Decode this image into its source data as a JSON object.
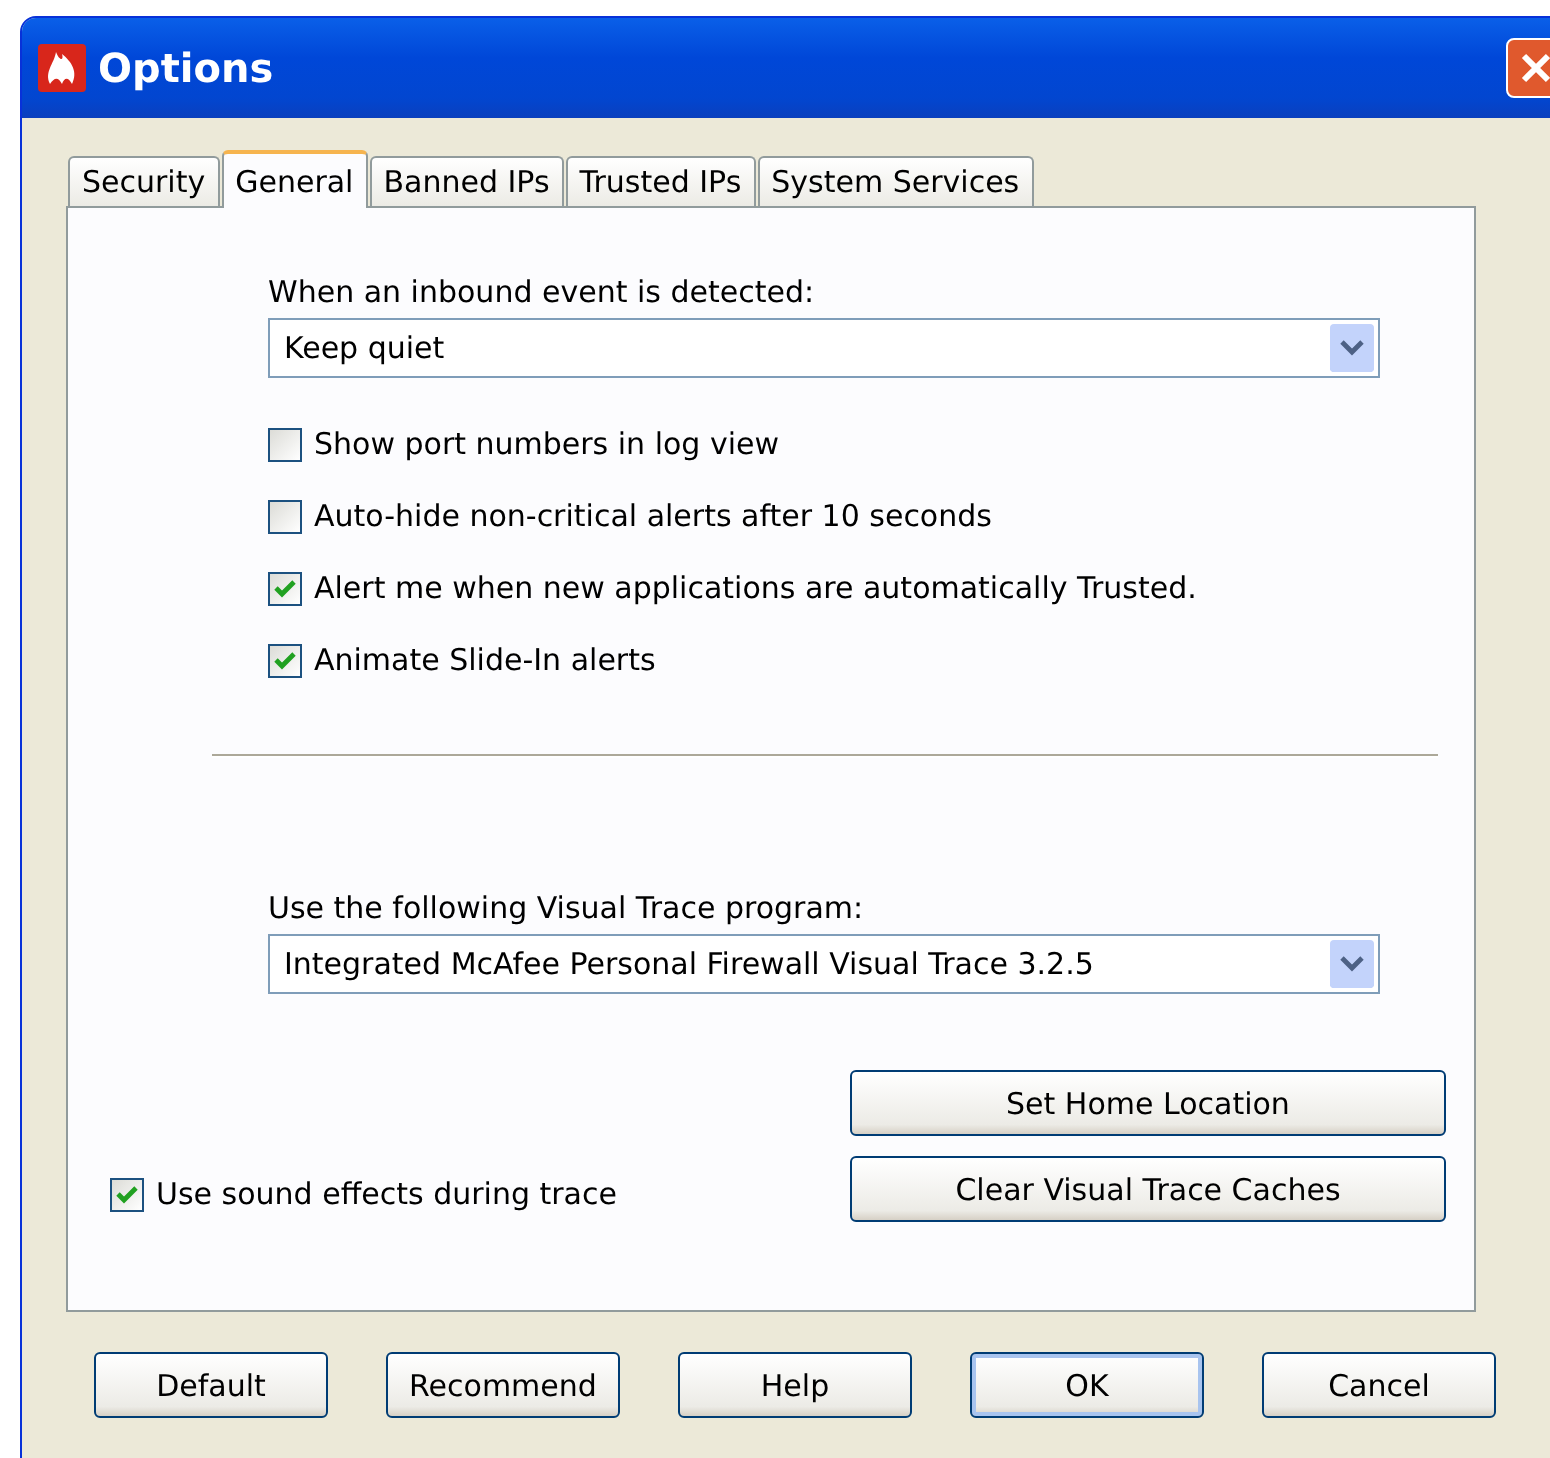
{
  "window": {
    "title": "Options"
  },
  "tabs": [
    {
      "label": "Security",
      "selected": false
    },
    {
      "label": "General",
      "selected": true
    },
    {
      "label": "Banned IPs",
      "selected": false
    },
    {
      "label": "Trusted IPs",
      "selected": false
    },
    {
      "label": "System Services",
      "selected": false
    }
  ],
  "inbound": {
    "label": "When an inbound event is detected:",
    "value": "Keep quiet"
  },
  "options": [
    {
      "label": "Show port numbers in log view",
      "checked": false
    },
    {
      "label": "Auto-hide non-critical alerts after 10 seconds",
      "checked": false
    },
    {
      "label": "Alert me when new applications are automatically Trusted.",
      "checked": true
    },
    {
      "label": "Animate Slide-In alerts",
      "checked": true
    }
  ],
  "trace": {
    "label": "Use the following Visual Trace program:",
    "value": "Integrated McAfee Personal Firewall Visual Trace 3.2.5"
  },
  "sound": {
    "label": "Use sound effects during trace",
    "checked": true
  },
  "trace_buttons": [
    "Set Home Location",
    "Clear Visual Trace Caches"
  ],
  "buttons": [
    {
      "label": "Default",
      "focused": false
    },
    {
      "label": "Recommend",
      "focused": false
    },
    {
      "label": "Help",
      "focused": false
    },
    {
      "label": "OK",
      "focused": true
    },
    {
      "label": "Cancel",
      "focused": false
    }
  ]
}
